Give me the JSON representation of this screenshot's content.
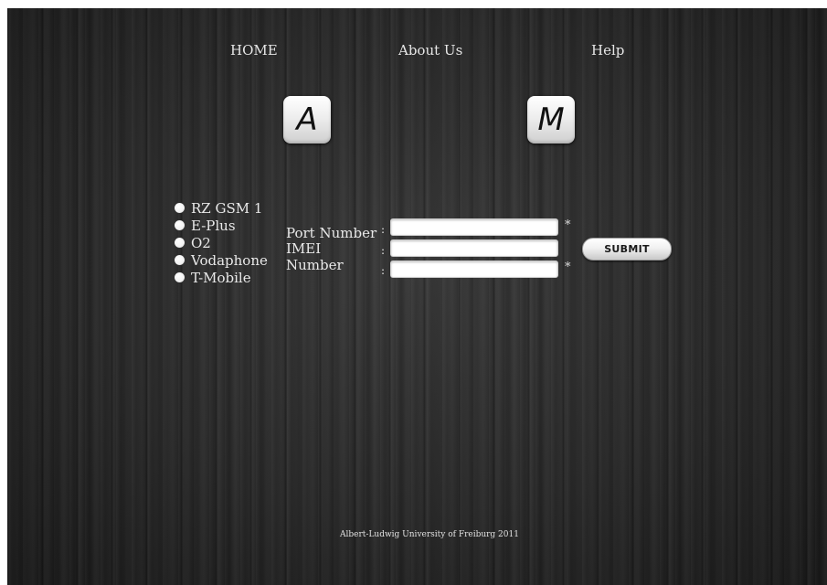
{
  "nav": {
    "home": "HOME",
    "about": "About Us",
    "help": "Help"
  },
  "logos": {
    "left_letter": "A",
    "right_letter": "M"
  },
  "providers": [
    {
      "label": "RZ GSM 1"
    },
    {
      "label": "E-Plus"
    },
    {
      "label": "O2"
    },
    {
      "label": "Vodaphone"
    },
    {
      "label": "T-Mobile"
    }
  ],
  "form": {
    "port_label": "Port Number",
    "imei_label": "IMEI",
    "number_label": "Number",
    "colon": ":",
    "required_mark": "*",
    "port_value": "",
    "imei_value": "",
    "number_value": "",
    "submit_label": "SUBMIT"
  },
  "footer": {
    "text": "Albert-Ludwig University of Freiburg 2011"
  },
  "colors": {
    "background": "#2b2b2b",
    "text": "#e9e9e9",
    "button": "#f1f1f1"
  }
}
